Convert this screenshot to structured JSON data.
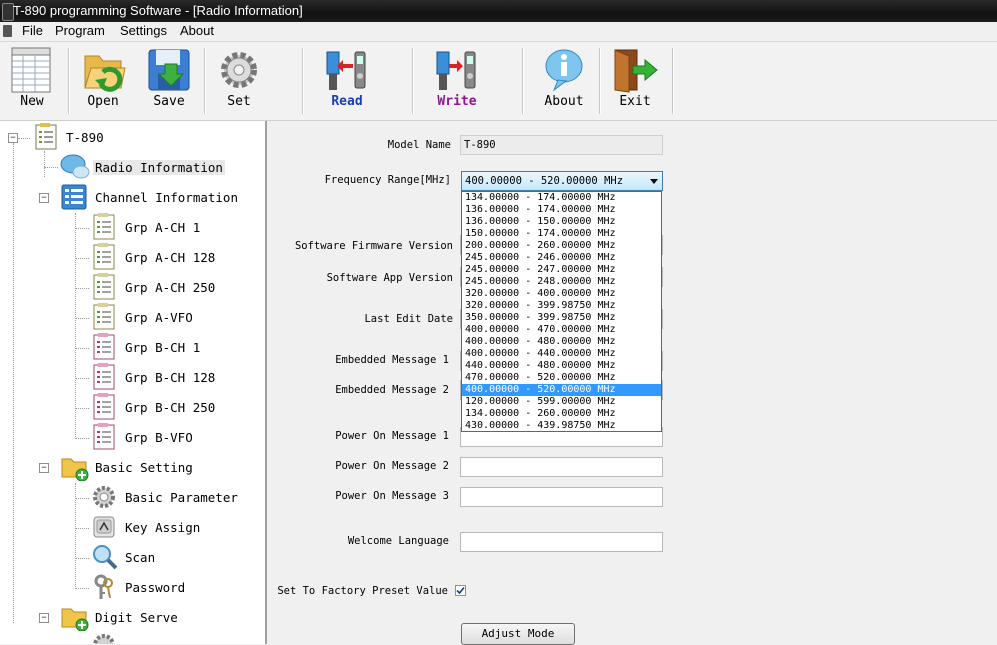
{
  "window": {
    "title": "T-890 programming Software - [Radio Information]"
  },
  "menu": [
    "File",
    "Program",
    "Settings",
    "About"
  ],
  "toolbar": {
    "new": "New",
    "open": "Open",
    "save": "Save",
    "set": "Set",
    "read": "Read",
    "write": "Write",
    "about": "About",
    "exit": "Exit"
  },
  "tree": {
    "root": "T-890",
    "radio_info": "Radio Information",
    "channel_info": "Channel Information",
    "channels": [
      "Grp A-CH 1",
      "Grp A-CH 128",
      "Grp A-CH 250",
      "Grp A-VFO",
      "Grp B-CH 1",
      "Grp B-CH 128",
      "Grp B-CH 250",
      "Grp B-VFO"
    ],
    "basic_setting": "Basic Setting",
    "basic_children": [
      "Basic Parameter",
      "Key Assign",
      "Scan",
      "Password"
    ],
    "digit_serve": "Digit Serve"
  },
  "form": {
    "model_name_label": "Model Name",
    "model_name_value": "T-890",
    "freq_label": "Frequency Range[MHz]",
    "freq_value": "400.00000 - 520.00000 MHz",
    "fw_label": "Software Firmware Version",
    "app_label": "Software App Version",
    "edit_date_label": "Last Edit Date",
    "embedded1_label": "Embedded Message 1",
    "embedded2_label": "Embedded Message 2",
    "poweron1_label": "Power On Message 1",
    "poweron2_label": "Power On Message 2",
    "poweron3_label": "Power On Message 3",
    "welcome_label": "Welcome Language",
    "factory_label": "Set To Factory Preset Value",
    "factory_checked": true,
    "adjust_button": "Adjust Mode"
  },
  "freq_options": [
    "134.00000 - 174.00000 MHz",
    "136.00000 - 174.00000 MHz",
    "136.00000 - 150.00000 MHz",
    "150.00000 - 174.00000 MHz",
    "200.00000 - 260.00000 MHz",
    "245.00000 - 246.00000 MHz",
    "245.00000 - 247.00000 MHz",
    "245.00000 - 248.00000 MHz",
    "320.00000 - 400.00000 MHz",
    "320.00000 - 399.98750 MHz",
    "350.00000 - 399.98750 MHz",
    "400.00000 - 470.00000 MHz",
    "400.00000 - 480.00000 MHz",
    "400.00000 - 440.00000 MHz",
    "440.00000 - 480.00000 MHz",
    "470.00000 - 520.00000 MHz",
    "400.00000 - 520.00000 MHz",
    "120.00000 - 599.00000 MHz",
    "134.00000 - 260.00000 MHz",
    "430.00000 - 439.98750 MHz"
  ],
  "freq_selected_index": 16,
  "colors": {
    "selection": "#3399ff",
    "read_label": "#1a3fae",
    "write_label": "#8a1a8a"
  }
}
